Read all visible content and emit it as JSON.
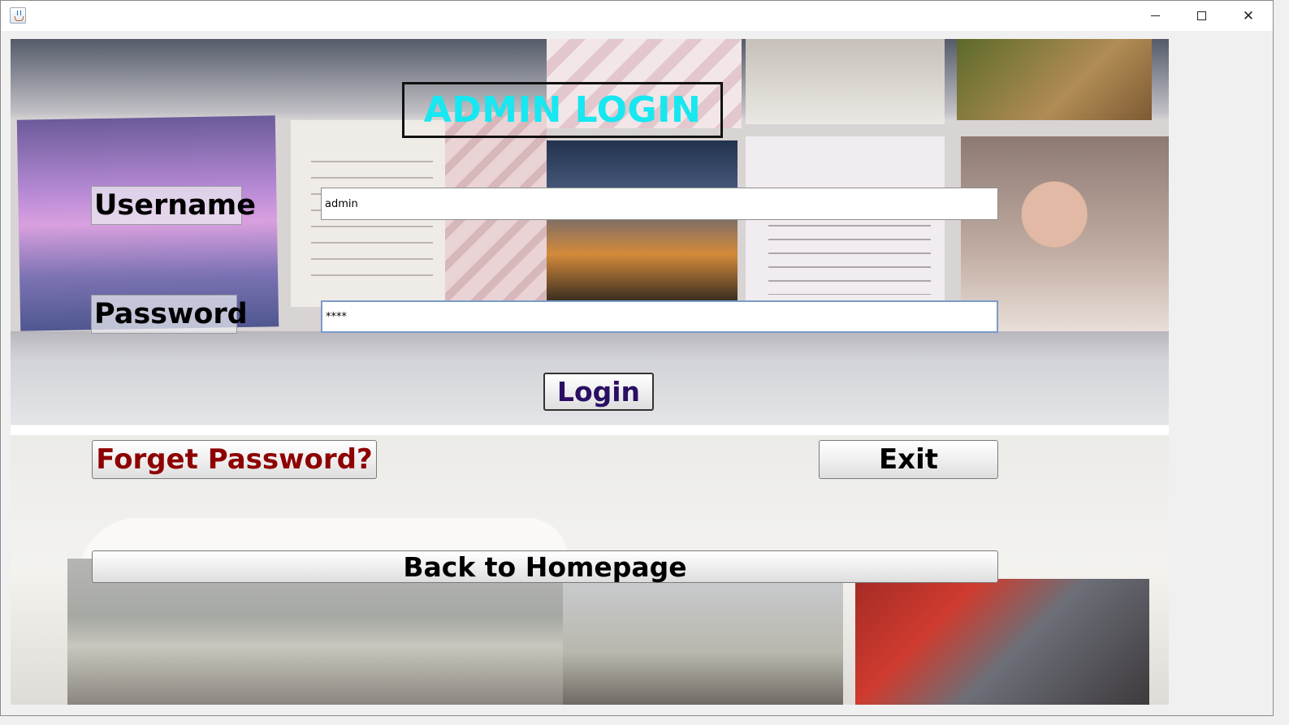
{
  "window": {
    "title": "",
    "controls": {
      "minimize": "minimize",
      "maximize": "maximize",
      "close": "✕"
    }
  },
  "heading": "ADMIN LOGIN",
  "form": {
    "username_label": "Username",
    "username_value": "admin",
    "password_label": "Password",
    "password_value": "****"
  },
  "buttons": {
    "login": "Login",
    "forget_password": "Forget Password?",
    "exit": "Exit",
    "back_home": "Back to Homepage"
  },
  "colors": {
    "heading": "#17e7f0",
    "login_text": "#2a0f63",
    "forget_text": "#8e0000"
  },
  "icons": [
    "java-app-icon",
    "minimize-icon",
    "maximize-icon",
    "close-icon"
  ]
}
